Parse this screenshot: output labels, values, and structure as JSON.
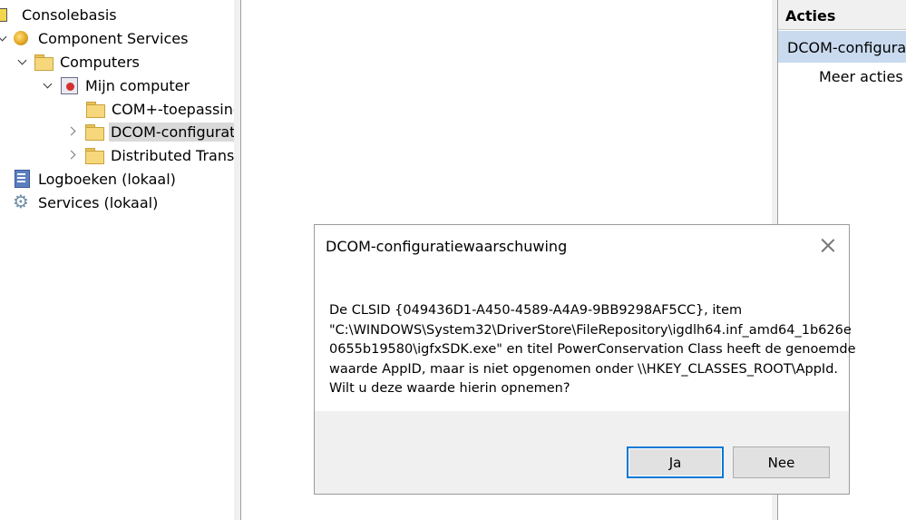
{
  "tree": {
    "items": [
      {
        "label": "Consolebasis"
      },
      {
        "label": "Component Services"
      },
      {
        "label": "Computers"
      },
      {
        "label": "Mijn computer"
      },
      {
        "label": "COM+-toepassingen"
      },
      {
        "label": "DCOM-configuratie"
      },
      {
        "label": "Distributed Transaction Coordinator"
      },
      {
        "label": "Logboeken (lokaal)"
      },
      {
        "label": "Services (lokaal)"
      }
    ]
  },
  "actions": {
    "header": "Acties",
    "section": "DCOM-configuratie",
    "more": "Meer acties"
  },
  "dialog": {
    "title": "DCOM-configuratiewaarschuwing",
    "message_lines": [
      "De CLSID {049436D1-A450-4589-A4A9-9BB9298AF5CC}, item",
      "\"C:\\WINDOWS\\System32\\DriverStore\\FileRepository\\igdlh64.inf_amd64_1b626e",
      "0655b19580\\igfxSDK.exe\" en titel PowerConservation Class heeft de genoemde",
      "waarde AppID, maar is niet opgenomen onder \\\\HKEY_CLASSES_ROOT\\AppId.",
      "Wilt u deze waarde hierin opnemen?"
    ],
    "yes_label": "Ja",
    "no_label": "Nee"
  }
}
